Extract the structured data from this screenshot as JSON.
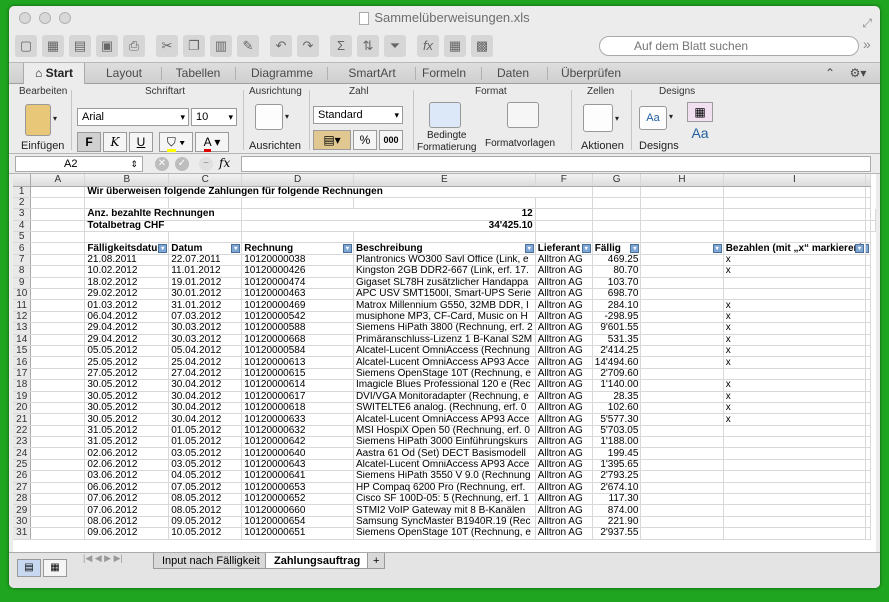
{
  "window": {
    "title": "Sammelüberweisungen.xls"
  },
  "search": {
    "placeholder": "Auf dem Blatt suchen"
  },
  "tabs": [
    "Start",
    "Layout",
    "Tabellen",
    "Diagramme",
    "SmartArt",
    "Formeln",
    "Daten",
    "Überprüfen"
  ],
  "ribbon": {
    "groups": {
      "bearbeiten": "Bearbeiten",
      "schriftart": "Schriftart",
      "ausrichtung": "Ausrichtung",
      "zahl": "Zahl",
      "format": "Format",
      "zellen": "Zellen",
      "designs": "Designs"
    },
    "einfuegen": "Einfügen",
    "font": "Arial",
    "size": "10",
    "bold": "F",
    "italic": "K",
    "underline": "U",
    "ausrichtung_btn": "Ausrichten",
    "number_format": "Standard",
    "percent": "%",
    "thousands": "000",
    "bedingte": "Bedingte",
    "formatierung": "Formatierung",
    "formatvorlagen": "Formatvorlagen",
    "aktionen": "Aktionen",
    "designs_btn": "Designs",
    "aa": "Aa"
  },
  "formula": {
    "cell": "A2",
    "fx": "fx",
    "value": ""
  },
  "columns": [
    "A",
    "B",
    "C",
    "D",
    "E",
    "F",
    "G",
    "H",
    "I"
  ],
  "cells": {
    "r1": "Wir überweisen folgende Zahlungen für folgende Rechnungen",
    "r3_label": "Anz. bezahlte Rechnungen",
    "r3_value": "12",
    "r4_label": "Totalbetrag CHF",
    "r4_value": "34'425.10",
    "headers": [
      "Fälligkeitsdatum",
      "Datum",
      "Rechnung",
      "Beschreibung",
      "Lieferant",
      "Fällig",
      "",
      "Bezahlen (mit „x“ markieren)"
    ]
  },
  "rows": [
    [
      "21.08.2011",
      "22.07.2011",
      "10120000038",
      "Plantronics WO300 Savl Office (Link, e",
      "Alltron AG",
      "469.25",
      "x"
    ],
    [
      "10.02.2012",
      "11.01.2012",
      "10120000426",
      "Kingston 2GB DDR2-667 (Link, erf. 17.",
      "Alltron AG",
      "80.70",
      "x"
    ],
    [
      "18.02.2012",
      "19.01.2012",
      "10120000474",
      "Gigaset SL78H zusätzlicher Handappa",
      "Alltron AG",
      "103.70",
      ""
    ],
    [
      "29.02.2012",
      "30.01.2012",
      "10120000463",
      "APC USV SMT1500I, Smart-UPS Serie",
      "Alltron AG",
      "698.70",
      ""
    ],
    [
      "01.03.2012",
      "31.01.2012",
      "10120000469",
      "Matrox Millennium G550, 32MB DDR, I",
      "Alltron AG",
      "284.10",
      "x"
    ],
    [
      "06.04.2012",
      "07.03.2012",
      "10120000542",
      "musiphone MP3, CF-Card, Music on H",
      "Alltron AG",
      "-298.95",
      "x"
    ],
    [
      "29.04.2012",
      "30.03.2012",
      "10120000588",
      "Siemens HiPath 3800 (Rechnung, erf. 2",
      "Alltron AG",
      "9'601.55",
      "x"
    ],
    [
      "29.04.2012",
      "30.03.2012",
      "10120000668",
      "Primäranschluss-Lizenz 1 B-Kanal S2M",
      "Alltron AG",
      "531.35",
      "x"
    ],
    [
      "05.05.2012",
      "05.04.2012",
      "10120000584",
      "Alcatel-Lucent OmniAccess (Rechnung",
      "Alltron AG",
      "2'414.25",
      "x"
    ],
    [
      "25.05.2012",
      "25.04.2012",
      "10120000613",
      "Alcatel-Lucent OmniAccess AP93 Acce",
      "Alltron AG",
      "14'494.60",
      "x"
    ],
    [
      "27.05.2012",
      "27.04.2012",
      "10120000615",
      "Siemens OpenStage 10T (Rechnung, e",
      "Alltron AG",
      "2'709.60",
      ""
    ],
    [
      "30.05.2012",
      "30.04.2012",
      "10120000614",
      "Imagicle Blues Professional 120 e (Rec",
      "Alltron AG",
      "1'140.00",
      "x"
    ],
    [
      "30.05.2012",
      "30.04.2012",
      "10120000617",
      "DVI/VGA Monitoradapter (Rechnung, e",
      "Alltron AG",
      "28.35",
      "x"
    ],
    [
      "30.05.2012",
      "30.04.2012",
      "10120000618",
      "SWITELTE6 analog. (Rechnung, erf. 0",
      "Alltron AG",
      "102.60",
      "x"
    ],
    [
      "30.05.2012",
      "30.04.2012",
      "10120000633",
      "Alcatel-Lucent OmniAccess AP93 Acce",
      "Alltron AG",
      "5'577.30",
      "x"
    ],
    [
      "31.05.2012",
      "01.05.2012",
      "10120000632",
      "MSI HospiX Open 50 (Rechnung, erf. 0",
      "Alltron AG",
      "5'703.05",
      ""
    ],
    [
      "31.05.2012",
      "01.05.2012",
      "10120000642",
      "Siemens HiPath 3000 Einführungskurs",
      "Alltron AG",
      "1'188.00",
      ""
    ],
    [
      "02.06.2012",
      "03.05.2012",
      "10120000640",
      "Aastra 61 Od (Set) DECT Basismodell",
      "Alltron AG",
      "199.45",
      ""
    ],
    [
      "02.06.2012",
      "03.05.2012",
      "10120000643",
      "Alcatel-Lucent OmniAccess AP93 Acce",
      "Alltron AG",
      "1'395.65",
      ""
    ],
    [
      "03.06.2012",
      "04.05.2012",
      "10120000641",
      "Siemens HiPath 3550 V 9.0 (Rechnung",
      "Alltron AG",
      "2'793.25",
      ""
    ],
    [
      "06.06.2012",
      "07.05.2012",
      "10120000653",
      "HP Compaq 6200 Pro (Rechnung, erf.",
      "Alltron AG",
      "2'674.10",
      ""
    ],
    [
      "07.06.2012",
      "08.05.2012",
      "10120000652",
      "Cisco SF 100D-05: 5 (Rechnung, erf. 1",
      "Alltron AG",
      "117.30",
      ""
    ],
    [
      "07.06.2012",
      "08.05.2012",
      "10120000660",
      "STMI2 VoIP Gateway mit 8 B-Kanälen",
      "Alltron AG",
      "874.00",
      ""
    ],
    [
      "08.06.2012",
      "09.05.2012",
      "10120000654",
      "Samsung SyncMaster B1940R.19 (Rec",
      "Alltron AG",
      "221.90",
      ""
    ],
    [
      "09.06.2012",
      "10.05.2012",
      "10120000651",
      "Siemens OpenStage 10T (Rechnung, e",
      "Alltron AG",
      "2'937.55",
      ""
    ]
  ],
  "sheets": [
    "Input nach Fälligkeit",
    "Zahlungsauftrag"
  ],
  "add_sheet": "+"
}
